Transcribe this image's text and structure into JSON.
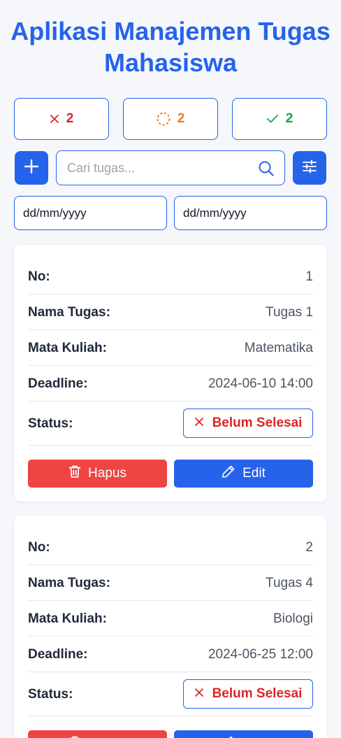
{
  "title": "Aplikasi Manajemen Tugas Mahasiswa",
  "stats": {
    "not_done": {
      "icon": "x-icon",
      "count": "2",
      "color": "#dc2626"
    },
    "in_progress": {
      "icon": "dashed-circle-icon",
      "count": "2",
      "color": "#ea7c24"
    },
    "done": {
      "icon": "check-icon",
      "count": "2",
      "color": "#16a34a"
    }
  },
  "toolbar": {
    "add_icon": "plus-icon",
    "search_placeholder": "Cari tugas...",
    "search_value": "",
    "search_icon": "search-icon",
    "filter_icon": "sliders-icon"
  },
  "date_filter": {
    "from": "dd/mm/yyyy",
    "to": "dd/mm/yyyy"
  },
  "labels": {
    "no": "No:",
    "name": "Nama Tugas:",
    "course": "Mata Kuliah:",
    "deadline": "Deadline:",
    "status": "Status:",
    "delete": "Hapus",
    "edit": "Edit"
  },
  "tasks": [
    {
      "no": "1",
      "name": "Tugas 1",
      "course": "Matematika",
      "deadline": "2024-06-10 14:00",
      "status": "Belum Selesai"
    },
    {
      "no": "2",
      "name": "Tugas 4",
      "course": "Biologi",
      "deadline": "2024-06-25 12:00",
      "status": "Belum Selesai"
    }
  ],
  "colors": {
    "primary": "#2563eb",
    "danger": "#ef4444",
    "background": "#f5f7fb"
  }
}
